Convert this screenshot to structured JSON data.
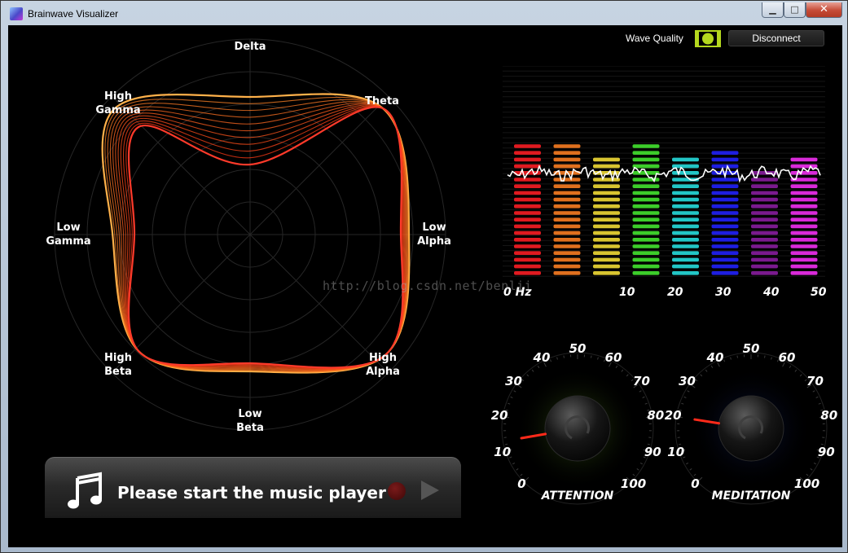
{
  "window": {
    "title": "Brainwave Visualizer",
    "controls": {
      "minimize": "▁",
      "maximize": "□",
      "close": "✕"
    }
  },
  "header": {
    "wave_quality_label": "Wave Quality",
    "wave_quality_icon": "signal-quality-icon",
    "disconnect_label": "Disconnect"
  },
  "radar": {
    "labels": {
      "delta": "Delta",
      "theta": "Theta",
      "low_alpha": [
        "Low",
        "Alpha"
      ],
      "high_alpha": [
        "High",
        "Alpha"
      ],
      "low_beta": [
        "Low",
        "Beta"
      ],
      "high_beta": [
        "High",
        "Beta"
      ],
      "low_gamma": [
        "Low",
        "Gamma"
      ],
      "high_gamma": [
        "High",
        "Gamma"
      ]
    }
  },
  "spectrum": {
    "freq_labels": [
      "0 Hz",
      "10",
      "20",
      "30",
      "40",
      "50"
    ],
    "bar_levels": [
      0.74,
      0.74,
      0.65,
      0.74,
      0.65,
      0.69,
      0.61,
      0.65
    ],
    "bar_colors": [
      "#e01a20",
      "#e0701e",
      "#d8c430",
      "#3ccd2a",
      "#22c6c6",
      "#1e1ee0",
      "#7a1a8e",
      "#d92ad9"
    ]
  },
  "attention": {
    "title": "ATTENTION",
    "ticks": [
      "0",
      "10",
      "20",
      "30",
      "40",
      "50",
      "60",
      "70",
      "80",
      "90",
      "100"
    ],
    "value": 13,
    "glow_color": "#2f4a10"
  },
  "meditation": {
    "title": "MEDITATION",
    "ticks": [
      "0",
      "10",
      "20",
      "30",
      "40",
      "50",
      "60",
      "70",
      "80",
      "90",
      "100"
    ],
    "value": 20,
    "glow_color": "#0b1540"
  },
  "music": {
    "icon": "music-note-icon",
    "text": "Please start the music player"
  },
  "watermark": "http://blog.csdn.net/benlii"
}
